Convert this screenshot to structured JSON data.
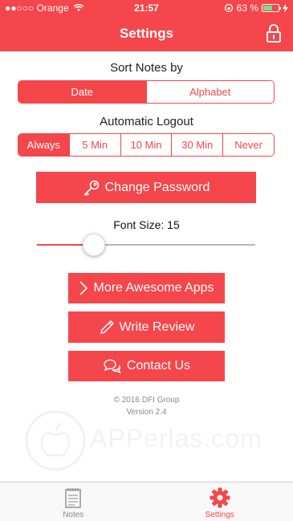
{
  "status_bar": {
    "signal_dots": "●●○○○",
    "carrier": "Orange",
    "time": "21:57",
    "battery_percent": "63 %",
    "battery_level": 0.63
  },
  "nav": {
    "title": "Settings",
    "lock_icon": "lock-icon"
  },
  "sort": {
    "label": "Sort Notes by",
    "options": [
      "Date",
      "Alphabet"
    ],
    "selected": "Date"
  },
  "logout": {
    "label": "Automatic Logout",
    "options": [
      "Always",
      "5 Min",
      "10 Min",
      "30 Min",
      "Never"
    ],
    "selected": "Always"
  },
  "change_password": {
    "label": "Change Password",
    "icon": "key-icon"
  },
  "font_size": {
    "label": "Font Size: 15",
    "value": 15,
    "level": 0.26
  },
  "actions": {
    "more_apps": {
      "label": "More Awesome Apps",
      "icon": "chevron-right-icon"
    },
    "write_review": {
      "label": "Write Review",
      "icon": "pencil-icon"
    },
    "contact_us": {
      "label": "Contact Us",
      "icon": "chat-icon"
    }
  },
  "footer": {
    "copyright": "© 2016 DFI Group",
    "version": "Version 2.4"
  },
  "watermark": {
    "text": "APPerlas.com"
  },
  "tabbar": {
    "tabs": [
      {
        "label": "Notes",
        "icon": "notes-icon",
        "active": false
      },
      {
        "label": "Settings",
        "icon": "gear-icon",
        "active": true
      }
    ]
  },
  "colors": {
    "accent": "#f4464b",
    "tab_inactive": "#8a8a8a",
    "track": "#b7b7b7"
  }
}
